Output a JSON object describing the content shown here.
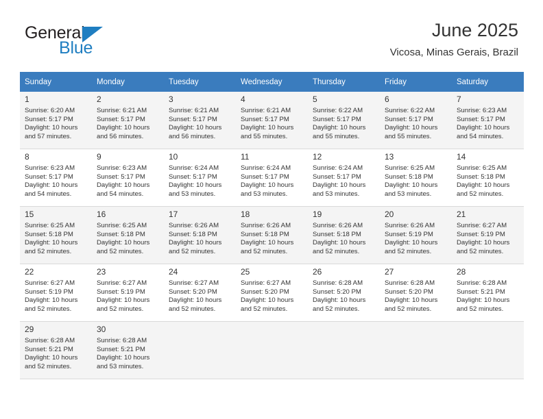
{
  "brand": {
    "name_top": "General",
    "name_bottom": "Blue",
    "accent_color": "#1f7ec1",
    "triangle_icon": "triangle-icon"
  },
  "header": {
    "title": "June 2025",
    "subtitle": "Vicosa, Minas Gerais, Brazil"
  },
  "calendar": {
    "header_bg": "#3a7cbe",
    "header_text_color": "#ffffff",
    "band_bg": "#f4f4f4",
    "weekdays": [
      "Sunday",
      "Monday",
      "Tuesday",
      "Wednesday",
      "Thursday",
      "Friday",
      "Saturday"
    ],
    "weeks": [
      [
        {
          "day": "1",
          "sunrise": "Sunrise: 6:20 AM",
          "sunset": "Sunset: 5:17 PM",
          "daylight1": "Daylight: 10 hours",
          "daylight2": "and 57 minutes."
        },
        {
          "day": "2",
          "sunrise": "Sunrise: 6:21 AM",
          "sunset": "Sunset: 5:17 PM",
          "daylight1": "Daylight: 10 hours",
          "daylight2": "and 56 minutes."
        },
        {
          "day": "3",
          "sunrise": "Sunrise: 6:21 AM",
          "sunset": "Sunset: 5:17 PM",
          "daylight1": "Daylight: 10 hours",
          "daylight2": "and 56 minutes."
        },
        {
          "day": "4",
          "sunrise": "Sunrise: 6:21 AM",
          "sunset": "Sunset: 5:17 PM",
          "daylight1": "Daylight: 10 hours",
          "daylight2": "and 55 minutes."
        },
        {
          "day": "5",
          "sunrise": "Sunrise: 6:22 AM",
          "sunset": "Sunset: 5:17 PM",
          "daylight1": "Daylight: 10 hours",
          "daylight2": "and 55 minutes."
        },
        {
          "day": "6",
          "sunrise": "Sunrise: 6:22 AM",
          "sunset": "Sunset: 5:17 PM",
          "daylight1": "Daylight: 10 hours",
          "daylight2": "and 55 minutes."
        },
        {
          "day": "7",
          "sunrise": "Sunrise: 6:23 AM",
          "sunset": "Sunset: 5:17 PM",
          "daylight1": "Daylight: 10 hours",
          "daylight2": "and 54 minutes."
        }
      ],
      [
        {
          "day": "8",
          "sunrise": "Sunrise: 6:23 AM",
          "sunset": "Sunset: 5:17 PM",
          "daylight1": "Daylight: 10 hours",
          "daylight2": "and 54 minutes."
        },
        {
          "day": "9",
          "sunrise": "Sunrise: 6:23 AM",
          "sunset": "Sunset: 5:17 PM",
          "daylight1": "Daylight: 10 hours",
          "daylight2": "and 54 minutes."
        },
        {
          "day": "10",
          "sunrise": "Sunrise: 6:24 AM",
          "sunset": "Sunset: 5:17 PM",
          "daylight1": "Daylight: 10 hours",
          "daylight2": "and 53 minutes."
        },
        {
          "day": "11",
          "sunrise": "Sunrise: 6:24 AM",
          "sunset": "Sunset: 5:17 PM",
          "daylight1": "Daylight: 10 hours",
          "daylight2": "and 53 minutes."
        },
        {
          "day": "12",
          "sunrise": "Sunrise: 6:24 AM",
          "sunset": "Sunset: 5:17 PM",
          "daylight1": "Daylight: 10 hours",
          "daylight2": "and 53 minutes."
        },
        {
          "day": "13",
          "sunrise": "Sunrise: 6:25 AM",
          "sunset": "Sunset: 5:18 PM",
          "daylight1": "Daylight: 10 hours",
          "daylight2": "and 53 minutes."
        },
        {
          "day": "14",
          "sunrise": "Sunrise: 6:25 AM",
          "sunset": "Sunset: 5:18 PM",
          "daylight1": "Daylight: 10 hours",
          "daylight2": "and 52 minutes."
        }
      ],
      [
        {
          "day": "15",
          "sunrise": "Sunrise: 6:25 AM",
          "sunset": "Sunset: 5:18 PM",
          "daylight1": "Daylight: 10 hours",
          "daylight2": "and 52 minutes."
        },
        {
          "day": "16",
          "sunrise": "Sunrise: 6:25 AM",
          "sunset": "Sunset: 5:18 PM",
          "daylight1": "Daylight: 10 hours",
          "daylight2": "and 52 minutes."
        },
        {
          "day": "17",
          "sunrise": "Sunrise: 6:26 AM",
          "sunset": "Sunset: 5:18 PM",
          "daylight1": "Daylight: 10 hours",
          "daylight2": "and 52 minutes."
        },
        {
          "day": "18",
          "sunrise": "Sunrise: 6:26 AM",
          "sunset": "Sunset: 5:18 PM",
          "daylight1": "Daylight: 10 hours",
          "daylight2": "and 52 minutes."
        },
        {
          "day": "19",
          "sunrise": "Sunrise: 6:26 AM",
          "sunset": "Sunset: 5:18 PM",
          "daylight1": "Daylight: 10 hours",
          "daylight2": "and 52 minutes."
        },
        {
          "day": "20",
          "sunrise": "Sunrise: 6:26 AM",
          "sunset": "Sunset: 5:19 PM",
          "daylight1": "Daylight: 10 hours",
          "daylight2": "and 52 minutes."
        },
        {
          "day": "21",
          "sunrise": "Sunrise: 6:27 AM",
          "sunset": "Sunset: 5:19 PM",
          "daylight1": "Daylight: 10 hours",
          "daylight2": "and 52 minutes."
        }
      ],
      [
        {
          "day": "22",
          "sunrise": "Sunrise: 6:27 AM",
          "sunset": "Sunset: 5:19 PM",
          "daylight1": "Daylight: 10 hours",
          "daylight2": "and 52 minutes."
        },
        {
          "day": "23",
          "sunrise": "Sunrise: 6:27 AM",
          "sunset": "Sunset: 5:19 PM",
          "daylight1": "Daylight: 10 hours",
          "daylight2": "and 52 minutes."
        },
        {
          "day": "24",
          "sunrise": "Sunrise: 6:27 AM",
          "sunset": "Sunset: 5:20 PM",
          "daylight1": "Daylight: 10 hours",
          "daylight2": "and 52 minutes."
        },
        {
          "day": "25",
          "sunrise": "Sunrise: 6:27 AM",
          "sunset": "Sunset: 5:20 PM",
          "daylight1": "Daylight: 10 hours",
          "daylight2": "and 52 minutes."
        },
        {
          "day": "26",
          "sunrise": "Sunrise: 6:28 AM",
          "sunset": "Sunset: 5:20 PM",
          "daylight1": "Daylight: 10 hours",
          "daylight2": "and 52 minutes."
        },
        {
          "day": "27",
          "sunrise": "Sunrise: 6:28 AM",
          "sunset": "Sunset: 5:20 PM",
          "daylight1": "Daylight: 10 hours",
          "daylight2": "and 52 minutes."
        },
        {
          "day": "28",
          "sunrise": "Sunrise: 6:28 AM",
          "sunset": "Sunset: 5:21 PM",
          "daylight1": "Daylight: 10 hours",
          "daylight2": "and 52 minutes."
        }
      ],
      [
        {
          "day": "29",
          "sunrise": "Sunrise: 6:28 AM",
          "sunset": "Sunset: 5:21 PM",
          "daylight1": "Daylight: 10 hours",
          "daylight2": "and 52 minutes."
        },
        {
          "day": "30",
          "sunrise": "Sunrise: 6:28 AM",
          "sunset": "Sunset: 5:21 PM",
          "daylight1": "Daylight: 10 hours",
          "daylight2": "and 53 minutes."
        },
        null,
        null,
        null,
        null,
        null
      ]
    ]
  }
}
